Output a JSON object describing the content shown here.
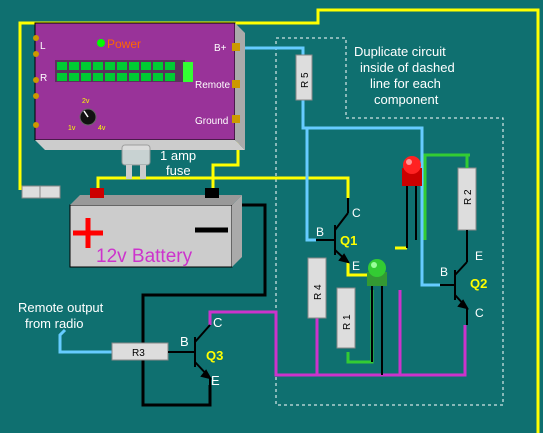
{
  "amp": {
    "power_label": "Power",
    "left_label": "L",
    "right_label": "R",
    "knob_2v": "2v",
    "knob_1v": "1v",
    "knob_4v": "4v",
    "terminal_bplus": "B+",
    "terminal_remote": "Remote",
    "terminal_ground": "Ground"
  },
  "fuse": {
    "line1": "1 amp",
    "line2": "fuse"
  },
  "battery": {
    "label": "12v Battery"
  },
  "note": {
    "line1": "Duplicate circuit",
    "line2": "inside of dashed",
    "line3": "line for each",
    "line4": "component"
  },
  "remote_input": {
    "line1": "Remote output",
    "line2": "from radio"
  },
  "resistors": {
    "r1": "R 1",
    "r2": "R 2",
    "r3": "R3",
    "r4": "R 4",
    "r5": "R 5"
  },
  "transistors": {
    "q1": {
      "name": "Q1",
      "b": "B",
      "c": "C",
      "e": "E"
    },
    "q2": {
      "name": "Q2",
      "b": "B",
      "c": "C",
      "e": "E"
    },
    "q3": {
      "name": "Q3",
      "b": "B",
      "c": "C",
      "e": "E"
    }
  },
  "colors": {
    "background": "#0f7070",
    "wire_power": "#ffff00",
    "wire_signal": "#66ccff",
    "wire_ground": "#000000",
    "wire_output": "#cc33cc",
    "wire_led": "#33cc33",
    "amp_body": "#993399",
    "battery_text": "#cc33cc",
    "transistor_label": "#ffff00"
  }
}
